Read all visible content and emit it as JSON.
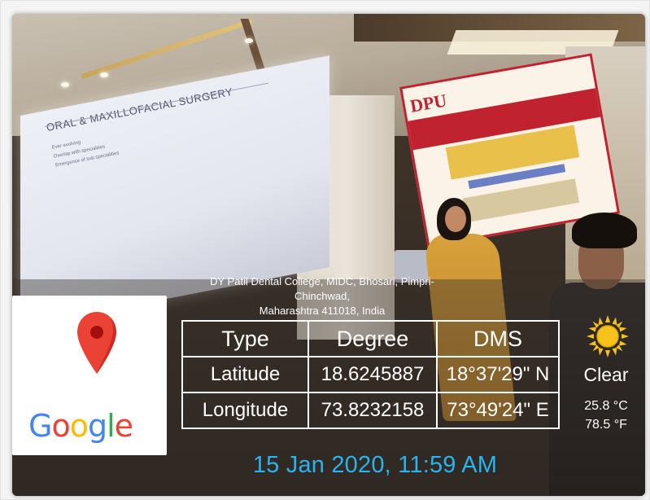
{
  "location": {
    "address_line1": "DY Patil Dental College, MIDC, Bhosari, Pimpri-Chinchwad,",
    "address_line2": "Maharashtra 411018, India"
  },
  "map_card": {
    "pin_icon": "map-pin-icon",
    "brand": "Google",
    "brand_letters": [
      {
        "ch": "G",
        "color": "#4285F4"
      },
      {
        "ch": "o",
        "color": "#EA4335"
      },
      {
        "ch": "o",
        "color": "#FBBC05"
      },
      {
        "ch": "g",
        "color": "#4285F4"
      },
      {
        "ch": "l",
        "color": "#34A853"
      },
      {
        "ch": "e",
        "color": "#EA4335"
      }
    ]
  },
  "coordinates_table": {
    "headers": [
      "Type",
      "Degree",
      "DMS"
    ],
    "rows": [
      {
        "type": "Latitude",
        "degree": "18.6245887",
        "dms": "18°37'29\" N"
      },
      {
        "type": "Longitude",
        "degree": "73.8232158",
        "dms": "73°49'24\" E"
      }
    ]
  },
  "weather": {
    "icon": "sun-icon",
    "condition": "Clear",
    "temp_c": "25.8 °C",
    "temp_f": "78.5 °F"
  },
  "timestamp": "15 Jan 2020, 11:59 AM",
  "scene": {
    "slide_title": "ORAL & MAXILLOFACIAL SURGERY",
    "slide_bullets": [
      "Ever evolving",
      "Overlap with specialities",
      "Emergence of sub specialities"
    ],
    "banner_logo": "DPU"
  },
  "colors": {
    "timestamp": "#27b4ef",
    "pin_red": "#EA4335",
    "sun_yellow": "#F6C21B"
  }
}
